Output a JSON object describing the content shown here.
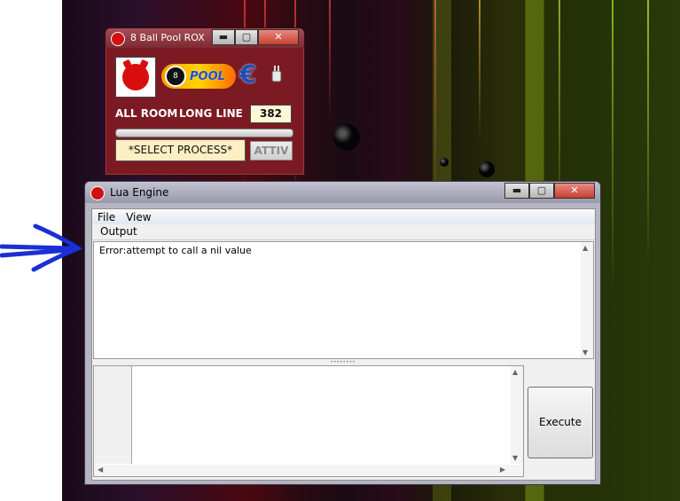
{
  "colors": {
    "annotation_arrow": "#1a2fd6",
    "rox_window_bg": "#7b1a22",
    "value_box_bg": "#fff8d6"
  },
  "rox_window": {
    "title": "8 Ball Pool ROX",
    "controls": {
      "minimize": "▬",
      "maximize": "▢",
      "close": "✕"
    },
    "logo_text": "POOL",
    "logo_ball": "8",
    "e_icon": "€",
    "all_room_label": "ALL ROOM",
    "long_line_label": "LONG LINE",
    "long_line_value": "382",
    "select_process_label": "*SELECT PROCESS*",
    "activate_label": "ATTIV"
  },
  "lua_window": {
    "title": "Lua Engine",
    "controls": {
      "minimize": "▬",
      "maximize": "▢",
      "close": "✕"
    },
    "menu": [
      "File",
      "View"
    ],
    "output_header": "Output",
    "output_text": "Error:attempt to call a nil value",
    "execute_label": "Execute"
  }
}
